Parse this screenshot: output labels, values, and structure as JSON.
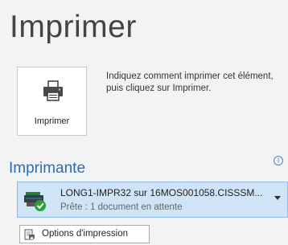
{
  "page": {
    "title": "Imprimer",
    "print_button_label": "Imprimer",
    "description": "Indiquez comment imprimer cet élément, puis cliquez sur Imprimer."
  },
  "printer": {
    "section_title": "Imprimante",
    "info_glyph": "i",
    "name": "LONG1-IMPR32 sur 16MOS001058.CISSSM...",
    "status": "Prête : 1 document en attente"
  },
  "options": {
    "label": "Options d'impression"
  },
  "colors": {
    "accent": "#2a6db5",
    "selected_background": "#cfe4f6",
    "status_ok": "#2e9e3a"
  }
}
